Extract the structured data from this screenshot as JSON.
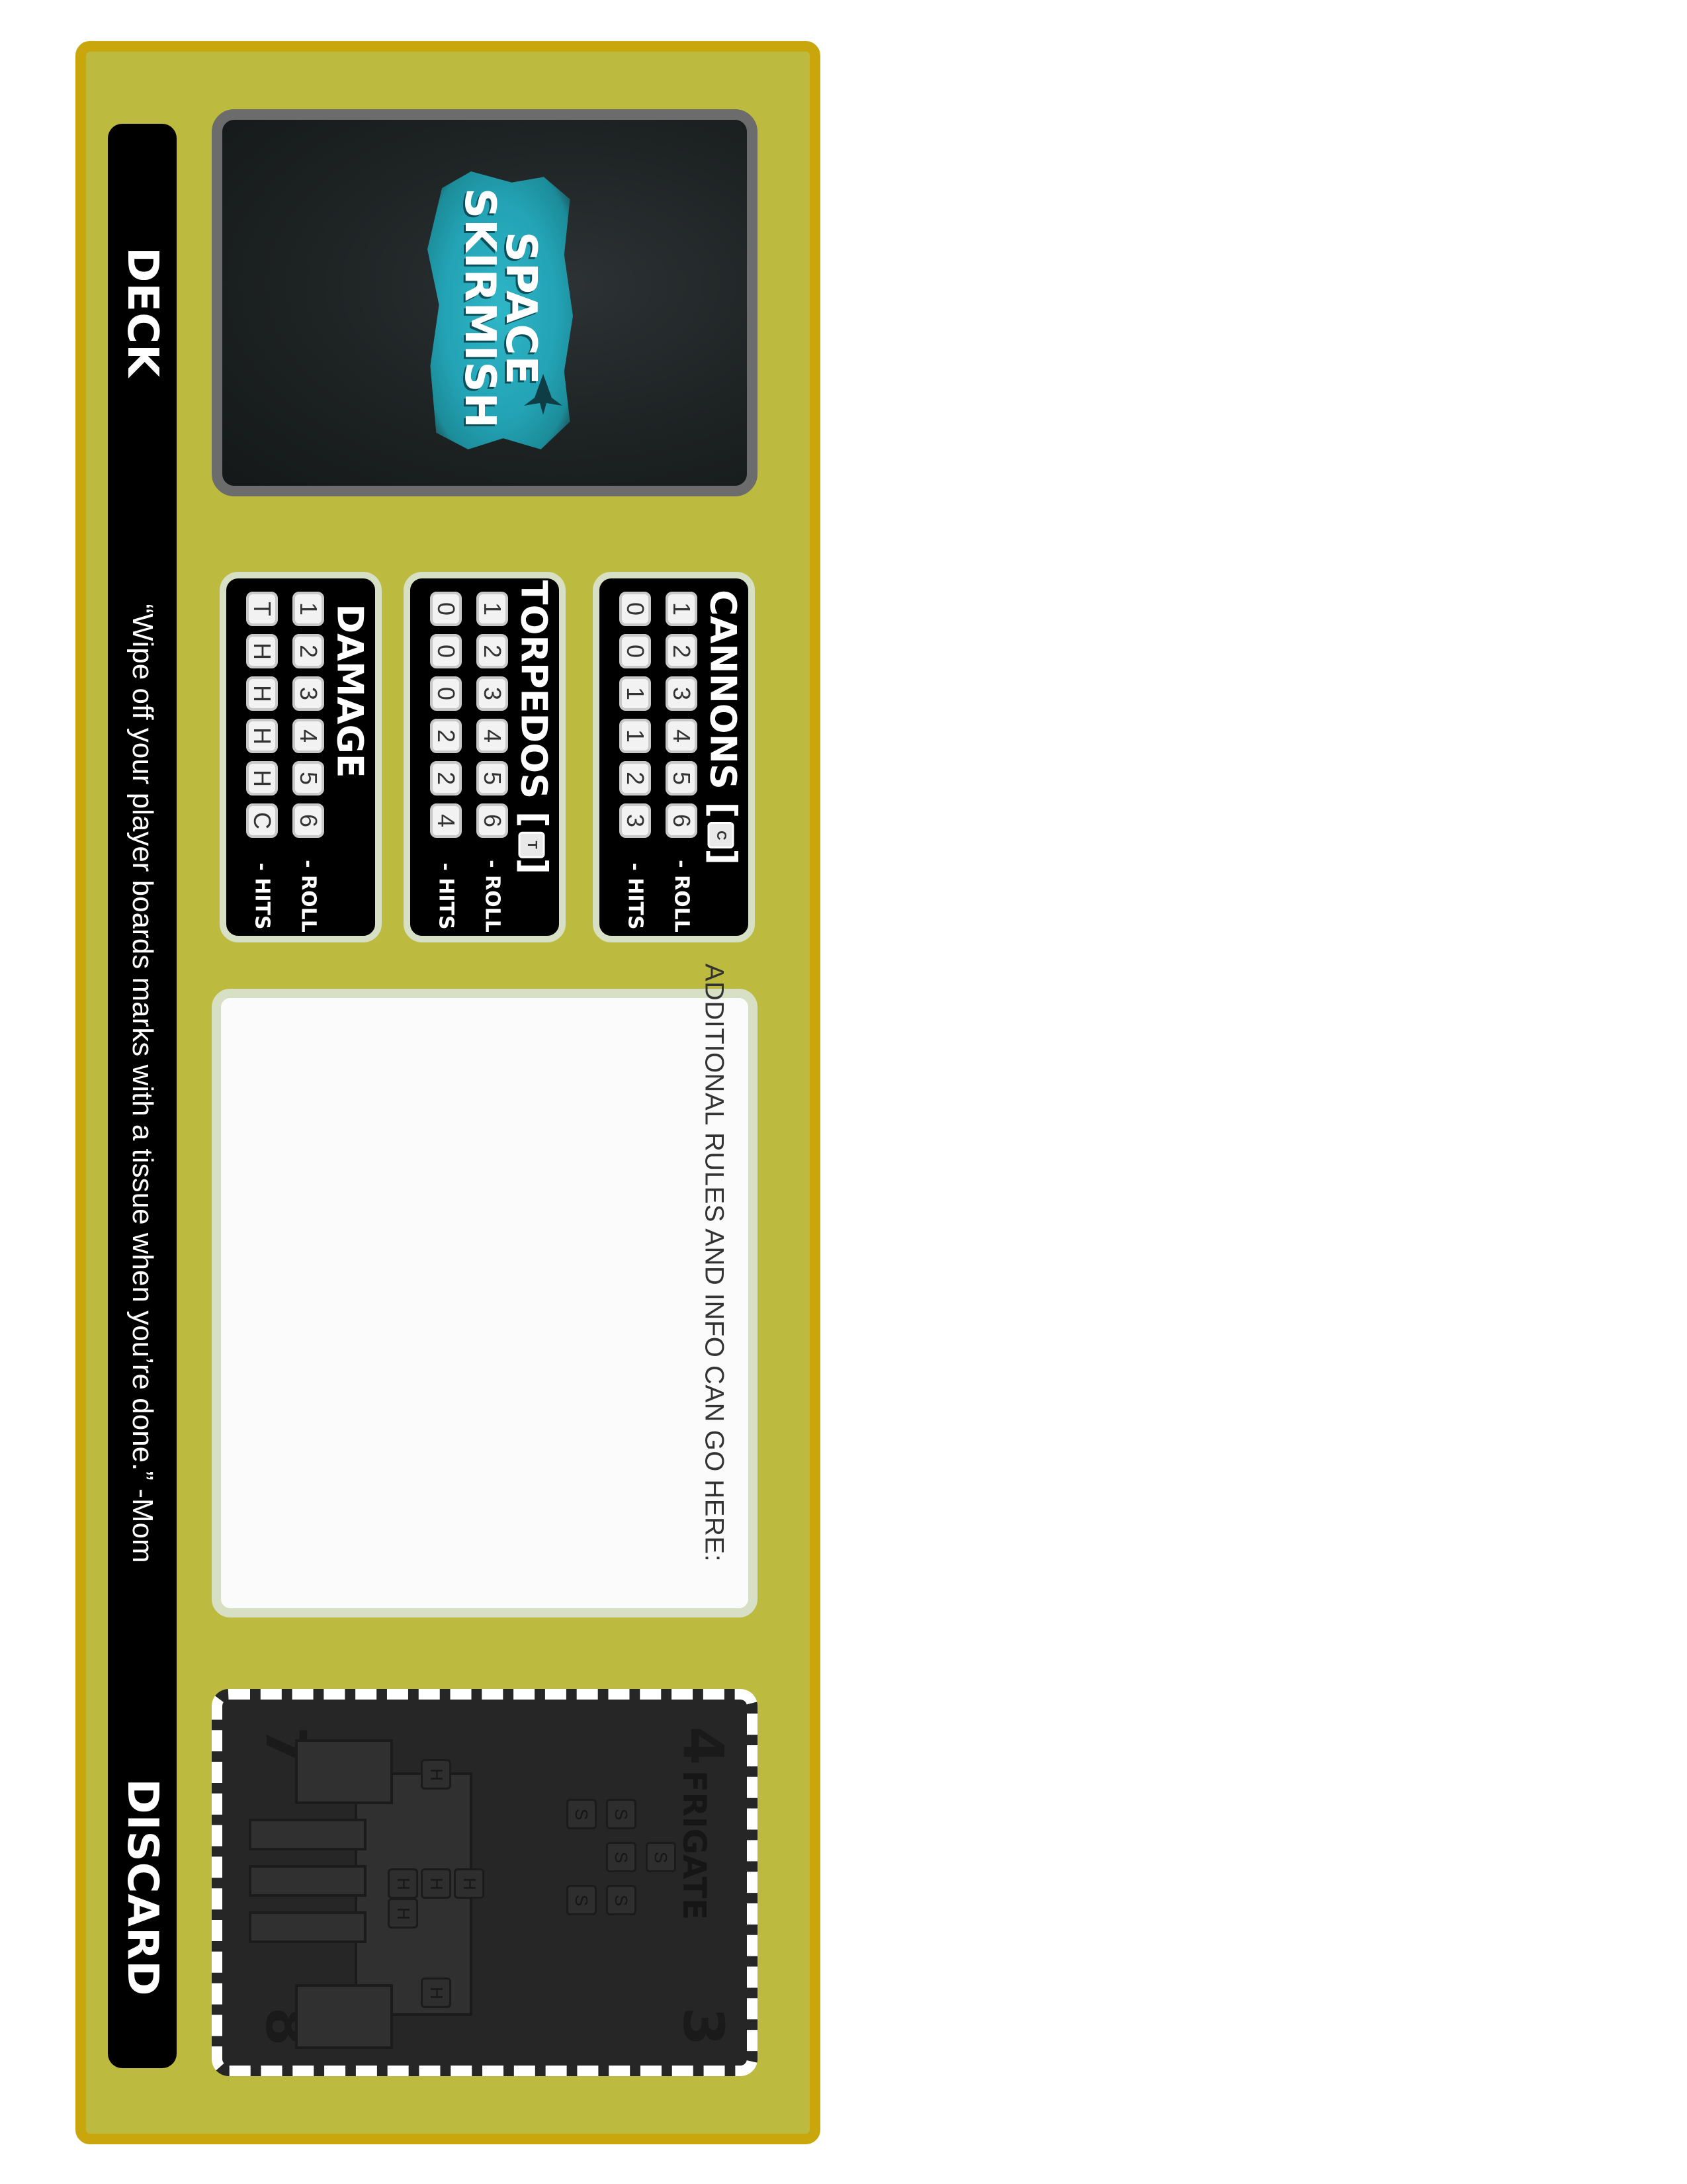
{
  "board": {
    "deck_label": "DECK",
    "discard_label": "DISCARD",
    "quote": "“Wipe off your player boards marks with a tissue when you’re done.” -Mom",
    "info_text": "ADDITIONAL RULES AND INFO CAN GO HERE:",
    "colors": {
      "board": "#bcbb3f",
      "border": "#c9a60c",
      "panel": "#000000",
      "panel_border": "#d7dfc4"
    }
  },
  "deck_card": {
    "logo_line1": "SPACE",
    "logo_line2": "SKIRMISH",
    "logo_icon": "spaceship-icon"
  },
  "panels": {
    "cannons": {
      "title": "CANNONS",
      "bracket_open": "[",
      "bracket_close": "]",
      "icon_letter": "C",
      "roll": [
        "1",
        "2",
        "3",
        "4",
        "5",
        "6"
      ],
      "hits": [
        "0",
        "0",
        "1",
        "1",
        "2",
        "3"
      ],
      "roll_label": "- ROLL",
      "hits_label": "- HITS"
    },
    "torpedos": {
      "title": "TORPEDOS",
      "bracket_open": "[",
      "bracket_close": "]",
      "icon_letter": "T",
      "roll": [
        "1",
        "2",
        "3",
        "4",
        "5",
        "6"
      ],
      "hits": [
        "0",
        "0",
        "0",
        "2",
        "2",
        "4"
      ],
      "roll_label": "- ROLL",
      "hits_label": "- HITS"
    },
    "damage": {
      "title": "DAMAGE",
      "roll": [
        "1",
        "2",
        "3",
        "4",
        "5",
        "6"
      ],
      "hits": [
        "T",
        "H",
        "H",
        "H",
        "H",
        "C"
      ],
      "roll_label": "- ROLL",
      "hits_label": "- HITS"
    }
  },
  "discard_card": {
    "title": "FRIGATE",
    "corner_top_left": "7",
    "corner_top_right": "4",
    "corner_bottom_left": "8",
    "corner_bottom_right": "3",
    "slots": [
      "S",
      "S",
      "S",
      "S",
      "S",
      "S"
    ],
    "hull": [
      "H",
      "H",
      "H",
      "H",
      "H",
      "H"
    ]
  }
}
